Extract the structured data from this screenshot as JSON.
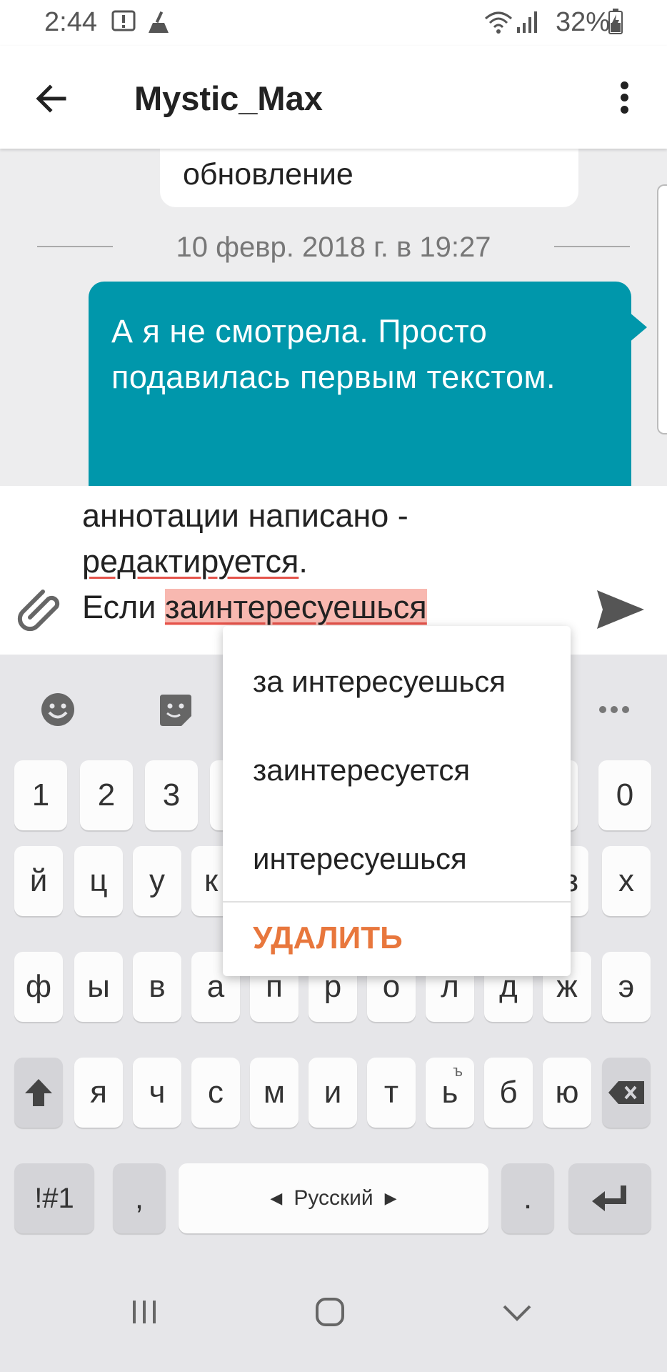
{
  "status_bar": {
    "time": "2:44",
    "battery": "32%"
  },
  "app_bar": {
    "title": "Mystic_Max"
  },
  "chat": {
    "previous_message_tail": "обновление",
    "date_divider": "10 февр. 2018 г. в 19:27",
    "sent_message": "А я не смотрела. Просто подавилась первым текстом."
  },
  "compose": {
    "line1": "аннотации написано -",
    "line2_word": "редактируется",
    "line2_end": ".",
    "line3_start": "Если ",
    "line3_word": "заинтересуешься"
  },
  "spell_popup": {
    "suggestions": [
      "за интересуешься",
      "заинтересуется",
      "интересуешься"
    ],
    "delete_label": "УДАЛИТЬ"
  },
  "keyboard": {
    "row_numbers": [
      "1",
      "2",
      "3",
      "0"
    ],
    "row1": [
      "й",
      "ц",
      "у",
      "к",
      "з",
      "х"
    ],
    "row2": [
      "ф",
      "ы",
      "в",
      "а",
      "п",
      "р",
      "о",
      "л",
      "д",
      "ж",
      "э"
    ],
    "row3": [
      "я",
      "ч",
      "с",
      "м",
      "и",
      "т",
      "ь",
      "б",
      "ю"
    ],
    "row3_alt": "ъ",
    "symbols_key": "!#1",
    "comma_key": ",",
    "space_label": "Русский",
    "period_key": "."
  },
  "colors": {
    "accent": "#0097ab",
    "delete_orange": "#e8773d",
    "misspelled_highlight": "#f8b8b0"
  }
}
